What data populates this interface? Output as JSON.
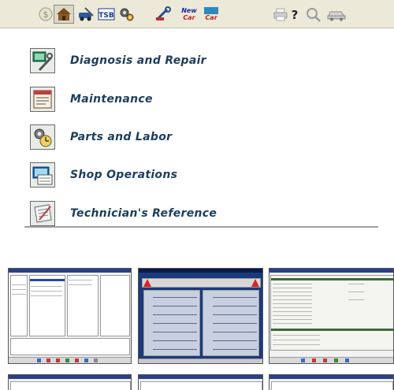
{
  "toolbar": {
    "buttons": [
      {
        "name": "dollar-coin-icon",
        "interactable": true
      },
      {
        "name": "home-icon",
        "interactable": true,
        "pressed": true
      },
      {
        "name": "car-tools-icon",
        "interactable": true
      },
      {
        "name": "tsb-icon",
        "interactable": true
      },
      {
        "name": "gears-icon",
        "interactable": true
      },
      {
        "name": "diagnostic-wrench-icon",
        "interactable": true
      },
      {
        "name": "new-car-icon",
        "interactable": true,
        "text": "New Car"
      },
      {
        "name": "car-icon",
        "interactable": true,
        "text": "Car"
      },
      {
        "name": "print-icon",
        "interactable": true
      },
      {
        "name": "help-icon",
        "interactable": true,
        "text": "?"
      },
      {
        "name": "search-icon",
        "interactable": true
      },
      {
        "name": "vehicle-icon",
        "interactable": true
      }
    ]
  },
  "menu": {
    "items": [
      {
        "label": "Diagnosis and Repair",
        "icon": "diagnosis-icon"
      },
      {
        "label": "Maintenance",
        "icon": "maintenance-icon"
      },
      {
        "label": "Parts and Labor",
        "icon": "parts-labor-icon"
      },
      {
        "label": "Shop Operations",
        "icon": "shop-operations-icon"
      },
      {
        "label": "Technician's Reference",
        "icon": "technician-reference-icon"
      }
    ]
  },
  "colors": {
    "menu_text": "#1d3e5c",
    "toolbar_bg": "#ece9d8",
    "thumb_title": "#2a3f8a"
  }
}
